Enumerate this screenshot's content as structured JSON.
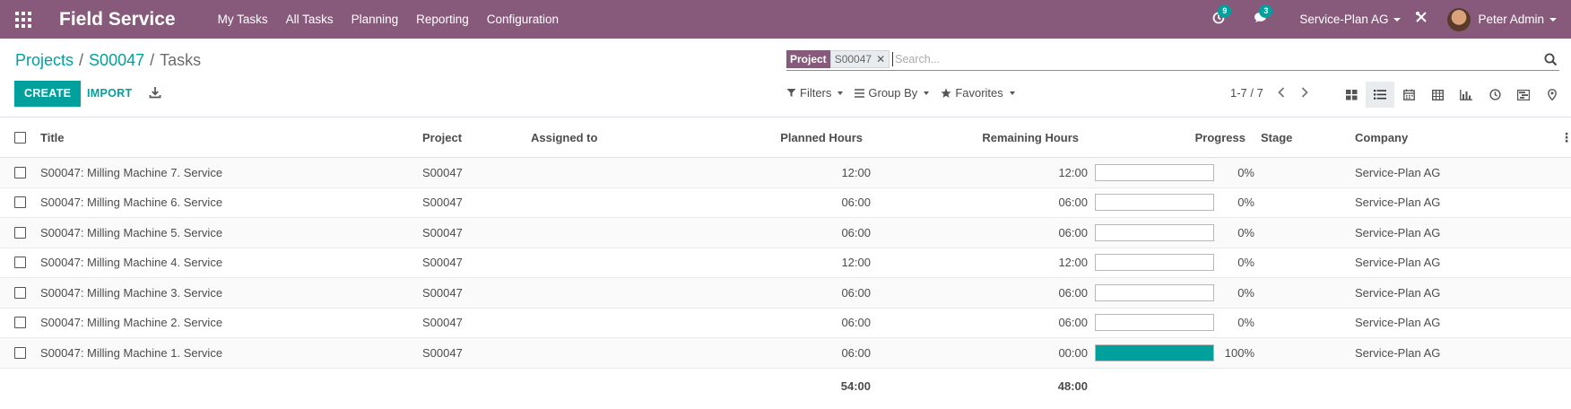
{
  "navbar": {
    "app_name": "Field Service",
    "menu": [
      "My Tasks",
      "All Tasks",
      "Planning",
      "Reporting",
      "Configuration"
    ],
    "activity_count": "9",
    "messages_count": "3",
    "company": "Service-Plan AG",
    "user": "Peter Admin"
  },
  "breadcrumb": {
    "items": [
      "Projects",
      "S00047"
    ],
    "current": "Tasks",
    "separator": "/"
  },
  "actions": {
    "create_label": "CREATE",
    "import_label": "IMPORT"
  },
  "search": {
    "facet_label": "Project",
    "facet_value": "S00047",
    "placeholder": "Search..."
  },
  "filters": {
    "filters_label": "Filters",
    "groupby_label": "Group By",
    "favorites_label": "Favorites"
  },
  "pager": {
    "range": "1-7 / 7"
  },
  "views": [
    "kanban",
    "list",
    "calendar",
    "pivot",
    "graph",
    "activity",
    "gantt",
    "map"
  ],
  "table": {
    "columns": {
      "title": "Title",
      "project": "Project",
      "assigned": "Assigned to",
      "planned": "Planned Hours",
      "remaining": "Remaining Hours",
      "progress": "Progress",
      "stage": "Stage",
      "company": "Company"
    },
    "rows": [
      {
        "title": "S00047: Milling Machine 7. Service",
        "project": "S00047",
        "assigned": "",
        "planned": "12:00",
        "remaining": "12:00",
        "progress": 0,
        "progress_label": "0%",
        "stage": "",
        "company": "Service-Plan AG"
      },
      {
        "title": "S00047: Milling Machine 6. Service",
        "project": "S00047",
        "assigned": "",
        "planned": "06:00",
        "remaining": "06:00",
        "progress": 0,
        "progress_label": "0%",
        "stage": "",
        "company": "Service-Plan AG"
      },
      {
        "title": "S00047: Milling Machine 5. Service",
        "project": "S00047",
        "assigned": "",
        "planned": "06:00",
        "remaining": "06:00",
        "progress": 0,
        "progress_label": "0%",
        "stage": "",
        "company": "Service-Plan AG"
      },
      {
        "title": "S00047: Milling Machine 4. Service",
        "project": "S00047",
        "assigned": "",
        "planned": "12:00",
        "remaining": "12:00",
        "progress": 0,
        "progress_label": "0%",
        "stage": "",
        "company": "Service-Plan AG"
      },
      {
        "title": "S00047: Milling Machine 3. Service",
        "project": "S00047",
        "assigned": "",
        "planned": "06:00",
        "remaining": "06:00",
        "progress": 0,
        "progress_label": "0%",
        "stage": "",
        "company": "Service-Plan AG"
      },
      {
        "title": "S00047: Milling Machine 2. Service",
        "project": "S00047",
        "assigned": "",
        "planned": "06:00",
        "remaining": "06:00",
        "progress": 0,
        "progress_label": "0%",
        "stage": "",
        "company": "Service-Plan AG"
      },
      {
        "title": "S00047: Milling Machine 1. Service",
        "project": "S00047",
        "assigned": "",
        "planned": "06:00",
        "remaining": "00:00",
        "progress": 100,
        "progress_label": "100%",
        "stage": "",
        "company": "Service-Plan AG"
      }
    ],
    "totals": {
      "planned": "54:00",
      "remaining": "48:00"
    }
  },
  "colors": {
    "brand": "#875a7b",
    "accent": "#00a09d"
  }
}
